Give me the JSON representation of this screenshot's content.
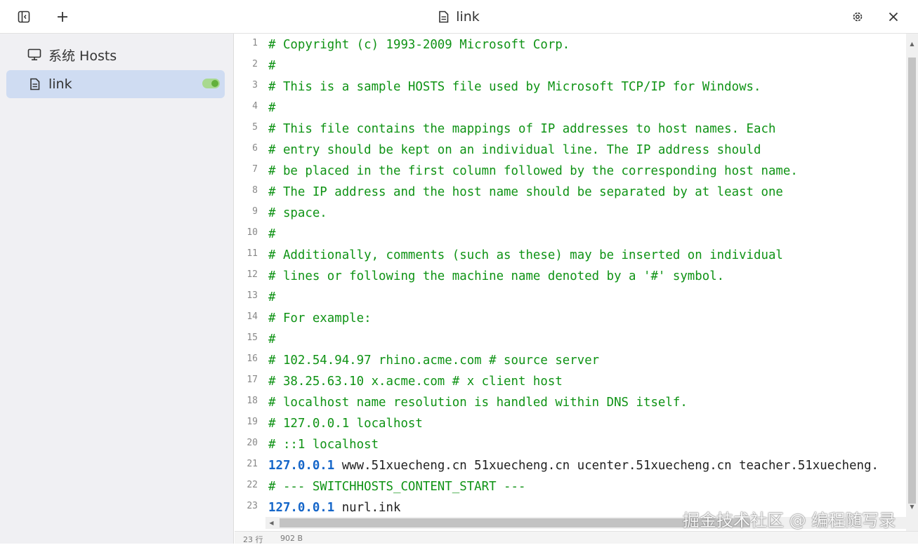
{
  "window": {
    "title": "link",
    "icons": {
      "sidebar_toggle": "sidebar-toggle-icon",
      "add": "plus-icon",
      "title_file": "file-icon",
      "settings": "gear-icon",
      "close": "close-icon"
    }
  },
  "sidebar": {
    "items": [
      {
        "label": "系统 Hosts",
        "icon": "monitor-icon",
        "active": false
      },
      {
        "label": "link",
        "icon": "file-icon",
        "active": true,
        "toggle_on": true
      }
    ]
  },
  "editor": {
    "lines": [
      {
        "num": "1",
        "parts": [
          {
            "t": "# Copyright (c) 1993-2009 Microsoft Corp.",
            "k": "comment"
          }
        ]
      },
      {
        "num": "2",
        "parts": [
          {
            "t": "#",
            "k": "comment"
          }
        ]
      },
      {
        "num": "3",
        "parts": [
          {
            "t": "# This is a sample HOSTS file used by Microsoft TCP/IP for Windows.",
            "k": "comment"
          }
        ]
      },
      {
        "num": "4",
        "parts": [
          {
            "t": "#",
            "k": "comment"
          }
        ]
      },
      {
        "num": "5",
        "parts": [
          {
            "t": "# This file contains the mappings of IP addresses to host names. Each",
            "k": "comment"
          }
        ]
      },
      {
        "num": "6",
        "parts": [
          {
            "t": "# entry should be kept on an individual line. The IP address should",
            "k": "comment"
          }
        ]
      },
      {
        "num": "7",
        "parts": [
          {
            "t": "# be placed in the first column followed by the corresponding host name.",
            "k": "comment"
          }
        ]
      },
      {
        "num": "8",
        "parts": [
          {
            "t": "# The IP address and the host name should be separated by at least one",
            "k": "comment"
          }
        ]
      },
      {
        "num": "9",
        "parts": [
          {
            "t": "# space.",
            "k": "comment"
          }
        ]
      },
      {
        "num": "10",
        "parts": [
          {
            "t": "#",
            "k": "comment"
          }
        ]
      },
      {
        "num": "11",
        "parts": [
          {
            "t": "# Additionally, comments (such as these) may be inserted on individual",
            "k": "comment"
          }
        ]
      },
      {
        "num": "12",
        "parts": [
          {
            "t": "# lines or following the machine name denoted by a '#' symbol.",
            "k": "comment"
          }
        ]
      },
      {
        "num": "13",
        "parts": [
          {
            "t": "#",
            "k": "comment"
          }
        ]
      },
      {
        "num": "14",
        "parts": [
          {
            "t": "# For example:",
            "k": "comment"
          }
        ]
      },
      {
        "num": "15",
        "parts": [
          {
            "t": "#",
            "k": "comment"
          }
        ]
      },
      {
        "num": "16",
        "parts": [
          {
            "t": "# 102.54.94.97 rhino.acme.com # source server",
            "k": "comment"
          }
        ]
      },
      {
        "num": "17",
        "parts": [
          {
            "t": "# 38.25.63.10 x.acme.com # x client host",
            "k": "comment"
          }
        ]
      },
      {
        "num": "18",
        "parts": [
          {
            "t": "# localhost name resolution is handled within DNS itself.",
            "k": "comment"
          }
        ]
      },
      {
        "num": "19",
        "parts": [
          {
            "t": "# 127.0.0.1 localhost",
            "k": "comment"
          }
        ]
      },
      {
        "num": "20",
        "parts": [
          {
            "t": "# ::1 localhost",
            "k": "comment"
          }
        ]
      },
      {
        "num": "21",
        "parts": [
          {
            "t": "127.0.0.1",
            "k": "ip"
          },
          {
            "t": " www.51xuecheng.cn 51xuecheng.cn ucenter.51xuecheng.cn teacher.51xuecheng.",
            "k": "text"
          }
        ]
      },
      {
        "num": "22",
        "parts": [
          {
            "t": "# --- SWITCHHOSTS_CONTENT_START ---",
            "k": "comment"
          }
        ]
      },
      {
        "num": "23",
        "parts": [
          {
            "t": "127.0.0.1",
            "k": "ip"
          },
          {
            "t": " nurl.ink",
            "k": "text"
          }
        ]
      }
    ]
  },
  "statusbar": {
    "lines": "23 行",
    "size": "902 B"
  },
  "watermark": "掘金技术社区 @ 编程随写录",
  "colors": {
    "comment": "#0f9315",
    "ip": "#1566c9",
    "active_item_bg": "#cfdcf2",
    "toggle_on": "#62b03b"
  }
}
